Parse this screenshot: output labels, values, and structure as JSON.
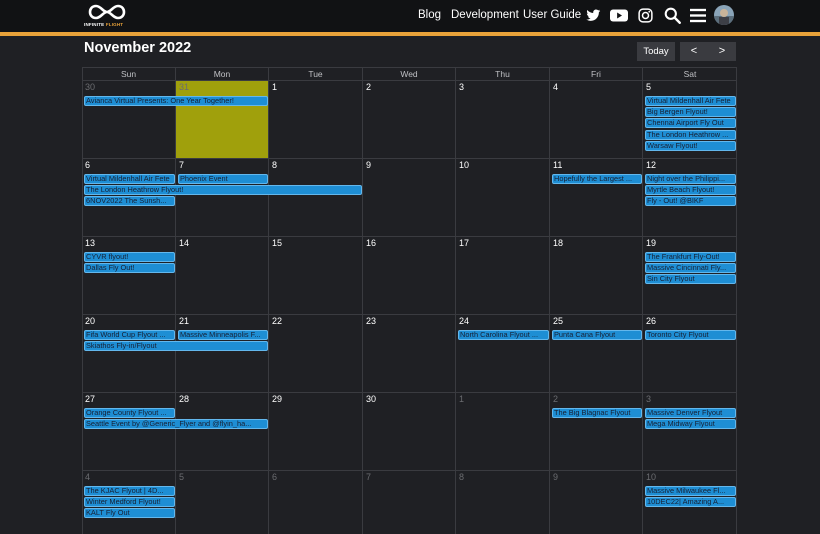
{
  "header": {
    "logo_text_main": "INFINITE",
    "logo_text_accent": "FLIGHT",
    "nav": [
      "Blog",
      "Development",
      "User Guide"
    ],
    "icons": [
      "twitter-icon",
      "youtube-icon",
      "instagram-icon",
      "search-icon",
      "hamburger-icon"
    ],
    "accent_color": "#e8a23a"
  },
  "calendar": {
    "title": "November 2022",
    "today_label": "Today",
    "prev_label": "<",
    "next_label": ">",
    "days_of_week": [
      "Sun",
      "Mon",
      "Tue",
      "Wed",
      "Thu",
      "Fri",
      "Sat"
    ],
    "today_color": "#a0a00c",
    "event_color": "#1e8ed4",
    "weeks": [
      {
        "days": [
          {
            "n": "30",
            "other": true
          },
          {
            "n": "31",
            "other": true,
            "today": true
          },
          {
            "n": "1"
          },
          {
            "n": "2"
          },
          {
            "n": "3"
          },
          {
            "n": "4"
          },
          {
            "n": "5"
          }
        ],
        "events": [
          {
            "title": "Avianca Virtual Presents: One Year Together!",
            "start": 0,
            "span": 2,
            "row": 0
          },
          {
            "title": "Virtual Mildenhall Air Fete",
            "start": 6,
            "span": 1,
            "row": 0
          },
          {
            "title": "Big Bergen Flyout!",
            "start": 6,
            "span": 1,
            "row": 1
          },
          {
            "title": "Chennai Airport Fly Out",
            "start": 6,
            "span": 1,
            "row": 2
          },
          {
            "title": "The London Heathrow ...",
            "start": 6,
            "span": 1,
            "row": 3
          },
          {
            "title": "Warsaw Flyout!",
            "start": 6,
            "span": 1,
            "row": 4
          }
        ]
      },
      {
        "days": [
          {
            "n": "6"
          },
          {
            "n": "7"
          },
          {
            "n": "8"
          },
          {
            "n": "9"
          },
          {
            "n": "10"
          },
          {
            "n": "11"
          },
          {
            "n": "12"
          }
        ],
        "events": [
          {
            "title": "Virtual Mildenhall Air Fete",
            "start": 0,
            "span": 1,
            "row": 0
          },
          {
            "title": "Phoenix Event",
            "start": 1,
            "span": 1,
            "row": 0
          },
          {
            "title": "Hopefully the Largest ...",
            "start": 5,
            "span": 1,
            "row": 0
          },
          {
            "title": "Night over the Philippi...",
            "start": 6,
            "span": 1,
            "row": 0
          },
          {
            "title": "The London Heathrow Flyout!",
            "start": 0,
            "span": 3,
            "row": 1
          },
          {
            "title": "Myrtle Beach Flyout!",
            "start": 6,
            "span": 1,
            "row": 1
          },
          {
            "title": "6NOV2022 The Sunsh...",
            "start": 0,
            "span": 1,
            "row": 2
          },
          {
            "title": "Fly - Out! @BIKF",
            "start": 6,
            "span": 1,
            "row": 2
          }
        ]
      },
      {
        "days": [
          {
            "n": "13"
          },
          {
            "n": "14"
          },
          {
            "n": "15"
          },
          {
            "n": "16"
          },
          {
            "n": "17"
          },
          {
            "n": "18"
          },
          {
            "n": "19"
          }
        ],
        "events": [
          {
            "title": "CYVR flyout!",
            "start": 0,
            "span": 1,
            "row": 0
          },
          {
            "title": "The Frankfurt Fly-Out!",
            "start": 6,
            "span": 1,
            "row": 0
          },
          {
            "title": "Dallas Fly Out!",
            "start": 0,
            "span": 1,
            "row": 1
          },
          {
            "title": "Massive Cincinnati Fly...",
            "start": 6,
            "span": 1,
            "row": 1
          },
          {
            "title": "Sin City Flyout",
            "start": 6,
            "span": 1,
            "row": 2
          }
        ]
      },
      {
        "days": [
          {
            "n": "20"
          },
          {
            "n": "21"
          },
          {
            "n": "22"
          },
          {
            "n": "23"
          },
          {
            "n": "24"
          },
          {
            "n": "25"
          },
          {
            "n": "26"
          }
        ],
        "events": [
          {
            "title": "Fifa World Cup Flyout ...",
            "start": 0,
            "span": 1,
            "row": 0
          },
          {
            "title": "Massive Minneapolis F...",
            "start": 1,
            "span": 1,
            "row": 0
          },
          {
            "title": "North Carolina Flyout ...",
            "start": 4,
            "span": 1,
            "row": 0
          },
          {
            "title": "Punta Cana Flyout",
            "start": 5,
            "span": 1,
            "row": 0
          },
          {
            "title": "Toronto City Flyout",
            "start": 6,
            "span": 1,
            "row": 0
          },
          {
            "title": "Skiathos Fly-in/Flyout",
            "start": 0,
            "span": 2,
            "row": 1
          }
        ]
      },
      {
        "days": [
          {
            "n": "27"
          },
          {
            "n": "28"
          },
          {
            "n": "29"
          },
          {
            "n": "30"
          },
          {
            "n": "1",
            "other": true
          },
          {
            "n": "2",
            "other": true
          },
          {
            "n": "3",
            "other": true
          }
        ],
        "events": [
          {
            "title": "Orange County Flyout ...",
            "start": 0,
            "span": 1,
            "row": 0
          },
          {
            "title": "The Big Blagnac Flyout",
            "start": 5,
            "span": 1,
            "row": 0
          },
          {
            "title": "Massive Denver Flyout",
            "start": 6,
            "span": 1,
            "row": 0
          },
          {
            "title": "Seattle Event by @Generic_Flyer and @flyin_ha...",
            "start": 0,
            "span": 2,
            "row": 1
          },
          {
            "title": "Mega Midway Flyout",
            "start": 6,
            "span": 1,
            "row": 1
          }
        ]
      },
      {
        "days": [
          {
            "n": "4",
            "other": true
          },
          {
            "n": "5",
            "other": true
          },
          {
            "n": "6",
            "other": true
          },
          {
            "n": "7",
            "other": true
          },
          {
            "n": "8",
            "other": true
          },
          {
            "n": "9",
            "other": true
          },
          {
            "n": "10",
            "other": true
          }
        ],
        "events": [
          {
            "title": "The KJAC Flyout | 4D...",
            "start": 0,
            "span": 1,
            "row": 0
          },
          {
            "title": "Massive Milwaukee Fl...",
            "start": 6,
            "span": 1,
            "row": 0
          },
          {
            "title": "Winter Medford Flyout!",
            "start": 0,
            "span": 1,
            "row": 1
          },
          {
            "title": "10DEC22| Amazing A...",
            "start": 6,
            "span": 1,
            "row": 1
          },
          {
            "title": "KALT Fly Out",
            "start": 0,
            "span": 1,
            "row": 2
          }
        ]
      }
    ]
  }
}
